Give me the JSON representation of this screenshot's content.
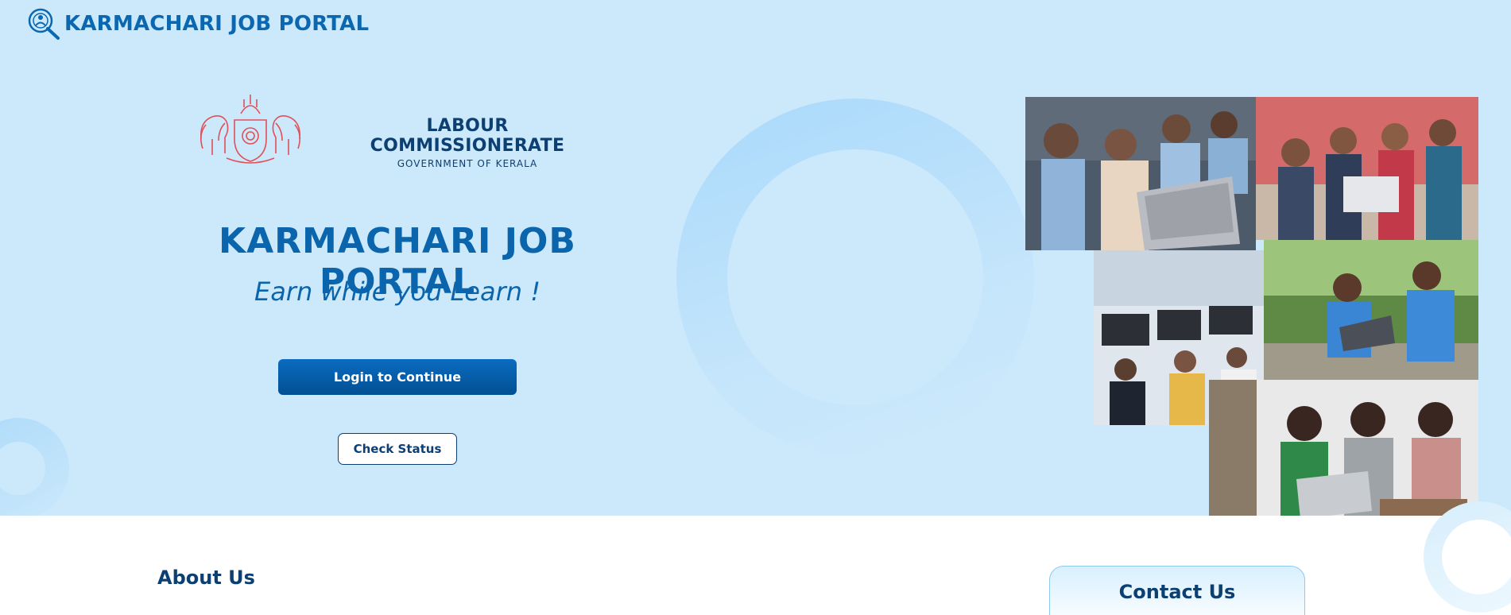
{
  "header": {
    "brand_title": "KARMACHARI JOB PORTAL",
    "logo_icon": "magnifier-person-logo"
  },
  "department": {
    "name": "LABOUR COMMISSIONERATE",
    "subtitle": "GOVERNMENT OF KERALA",
    "emblem_icon": "kerala-state-emblem"
  },
  "hero": {
    "title": "KARMACHARI JOB PORTAL",
    "tagline": "Earn while you Learn !",
    "login_label": "Login to Continue",
    "status_label": "Check Status"
  },
  "collage": {
    "photos": [
      "students-with-teacher-laptop",
      "young-adults-group-laptop",
      "office-computer-workspace",
      "schoolgirls-with-laptop-outdoors",
      "young-women-studying-laptop"
    ]
  },
  "sections": {
    "about_title": "About Us",
    "contact_title": "Contact Us"
  },
  "colors": {
    "hero_background": "#cce9fc",
    "brand_blue": "#0b65ac",
    "navy": "#0c3f72",
    "button_blue": "#0b6cc0"
  }
}
